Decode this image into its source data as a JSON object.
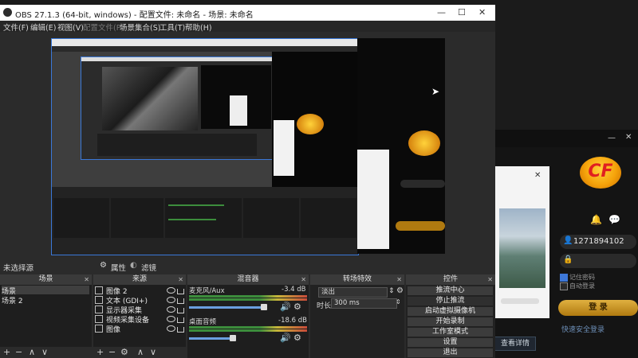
{
  "window": {
    "title": "OBS 27.1.3 (64-bit, windows) - 配置文件: 未命名 - 场景: 未命名",
    "controls": [
      "—",
      "☐",
      "✕"
    ]
  },
  "menu": [
    {
      "label": "文件(F)",
      "enabled": true
    },
    {
      "label": "编辑(E)",
      "enabled": true
    },
    {
      "label": "视图(V)",
      "enabled": true
    },
    {
      "label": "配置文件(P)",
      "enabled": false
    },
    {
      "label": "场景集合(S)",
      "enabled": true
    },
    {
      "label": "工具(T)",
      "enabled": true
    },
    {
      "label": "帮助(H)",
      "enabled": true
    }
  ],
  "status": {
    "no_source": "未选择源",
    "properties": "属性",
    "filters": "滤镜"
  },
  "docks": {
    "scenes": {
      "title": "场景",
      "items": [
        "场景",
        "场景 2"
      ]
    },
    "sources": {
      "title": "来源",
      "items": [
        {
          "label": "图像 2",
          "icon": "image-icon"
        },
        {
          "label": "文本 (GDI+)",
          "icon": "text-icon"
        },
        {
          "label": "显示器采集",
          "icon": "monitor-icon"
        },
        {
          "label": "视频采集设备",
          "icon": "camera-icon"
        },
        {
          "label": "图像",
          "icon": "image-icon"
        }
      ]
    },
    "mixer": {
      "title": "混音器",
      "channels": [
        {
          "name": "麦克风/Aux",
          "db": "-3.4 dB",
          "volume": 0.85
        },
        {
          "name": "桌面音频",
          "db": "-18.6 dB",
          "volume": 0.5
        }
      ]
    },
    "transitions": {
      "title": "转场特效",
      "type": "淡出",
      "duration_label": "时长",
      "duration": "300 ms"
    },
    "controls": {
      "title": "控件",
      "buttons": [
        "推流中心",
        "停止推流",
        "启动虚拟摄像机",
        "开始录制",
        "工作室模式",
        "设置",
        "退出"
      ]
    }
  },
  "login": {
    "account": "1271894102",
    "remember_label": "记住密码",
    "auto_login_label": "自动登录",
    "login_button": "登 录",
    "security_link": "快速安全登录",
    "details_button": "查看详情",
    "logo_text": "CF"
  },
  "popup": {
    "close": "✕"
  },
  "colors": {
    "accent": "#3a78d8",
    "meter_green": "#3c8d3c",
    "gold": "#e0b040"
  }
}
